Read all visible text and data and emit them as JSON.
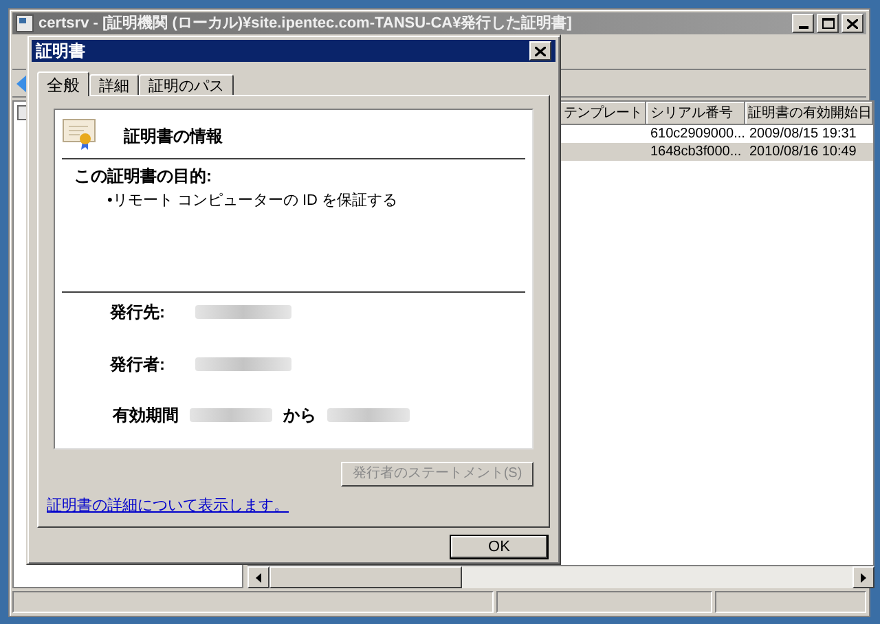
{
  "main_window": {
    "title": "certsrv - [証明機関 (ローカル)¥site.ipentec.com-TANSU-CA¥発行した証明書]",
    "table": {
      "columns": [
        "テンプレート",
        "シリアル番号",
        "証明書の有効開始日"
      ],
      "rows": [
        {
          "cells": [
            "",
            "610c2909000...",
            "2009/08/15 19:31"
          ],
          "selected": false
        },
        {
          "cells": [
            "",
            "1648cb3f000...",
            "2010/08/16 10:49"
          ],
          "selected": true
        }
      ]
    }
  },
  "dialog": {
    "title": "証明書",
    "tabs": [
      {
        "label": "全般",
        "selected": true
      },
      {
        "label": "詳細",
        "selected": false
      },
      {
        "label": "証明のパス",
        "selected": false
      }
    ],
    "heading": "証明書の情報",
    "purpose_label": "この証明書の目的:",
    "purposes": [
      "•リモート コンピューターの ID を保証する"
    ],
    "fields": [
      {
        "label": "発行先:"
      },
      {
        "label": "発行者:"
      }
    ],
    "validity": {
      "label": "有効期間",
      "connector": "から"
    },
    "statement_button": {
      "label": "発行者のステートメント(S)",
      "disabled": true
    },
    "details_link": "証明書の詳細について表示します。",
    "ok_button": "OK"
  }
}
